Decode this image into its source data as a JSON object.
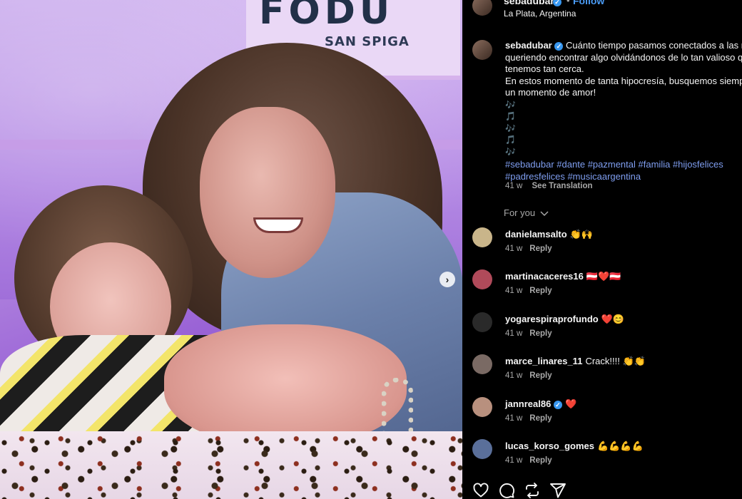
{
  "post": {
    "username": "sebadubar",
    "separator": "•",
    "follow_label": "Follow",
    "location": "La Plata, Argentina",
    "photo_sign_big": "FODU",
    "photo_sign_small": "SAN SPIGA"
  },
  "caption": {
    "username": "sebadubar",
    "lines": [
      "Cuánto tiempo pasamos conectados a las r",
      "queriendo encontrar algo olvidándonos de lo tan valioso q",
      "tenemos tan cerca.",
      "En estos momento de tanta hipocresía, busquemos siemp",
      "un momento de amor!"
    ],
    "notes": [
      "🎶",
      "🎵",
      "🎶",
      "🎵",
      "🎶"
    ],
    "hashtags_line1": [
      "#sebadubar",
      "#dante",
      "#pazmental",
      "#familia",
      "#hijosfelices"
    ],
    "hashtags_line2": [
      "#padresfelices",
      "#musicaargentina"
    ],
    "age": "41 w",
    "see_translation": "See Translation"
  },
  "for_you_label": "For you",
  "comments": [
    {
      "user": "danielamsalto",
      "text": "👏🙌",
      "age": "41 w",
      "reply": "Reply",
      "avatar_color": "#c9b58a"
    },
    {
      "user": "martinacaceres16",
      "text": "🇦🇹❤️🇦🇹",
      "age": "41 w",
      "reply": "Reply",
      "avatar_color": "#b04a5a"
    },
    {
      "user": "yogarespiraprofundo",
      "text": "❤️😊",
      "age": "41 w",
      "reply": "Reply",
      "avatar_color": "#2a2a2a"
    },
    {
      "user": "marce_linares_11",
      "text": "Crack!!!! 👏👏",
      "age": "41 w",
      "reply": "Reply",
      "avatar_color": "#7a6a64"
    },
    {
      "user": "jannreal86",
      "text": "❤️",
      "age": "41 w",
      "reply": "Reply",
      "avatar_color": "#b8907e",
      "verified": true
    },
    {
      "user": "lucas_korso_gomes",
      "text": "💪💪💪💪",
      "age": "41 w",
      "reply": "Reply",
      "avatar_color": "#5a6f9a"
    }
  ],
  "carousel_next_glyph": "›",
  "icons": {
    "like": "heart-icon",
    "comment": "comment-icon",
    "repost": "repost-icon",
    "share": "share-icon"
  }
}
